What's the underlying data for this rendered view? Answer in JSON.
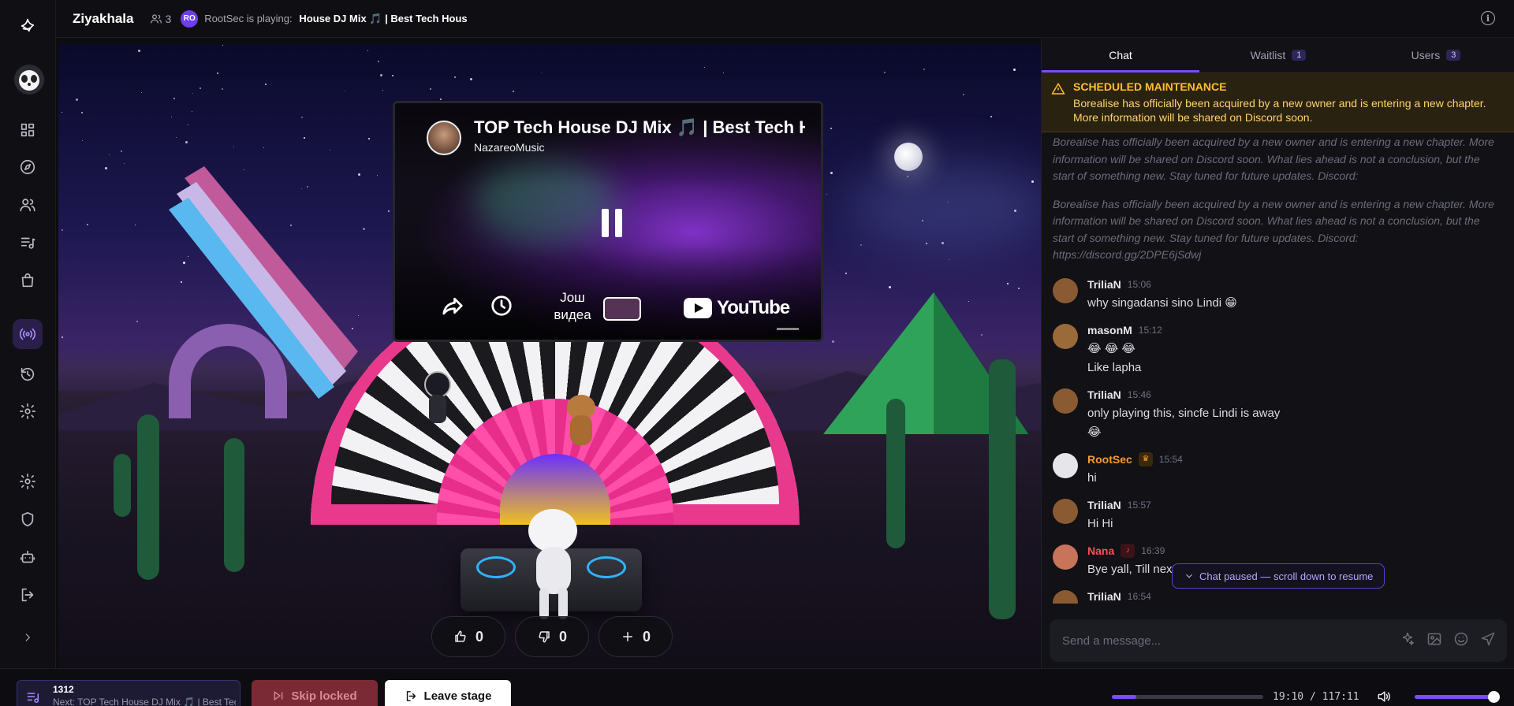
{
  "topbar": {
    "room_name": "Ziyakhala",
    "listener_count": "3",
    "dj_initials": "RO",
    "playing_label": "RootSec is playing:",
    "playing_title": "TOP Tech House DJ Mix 🎵 | Best Tech House"
  },
  "video": {
    "title": "TOP Tech House DJ Mix 🎵 | Best Tech House",
    "channel": "NazareoMusic",
    "watch_more": "Још\nвидеа",
    "youtube": "YouTube"
  },
  "votes": {
    "like": "0",
    "dislike": "0",
    "grab": "0"
  },
  "chat": {
    "tabs": [
      {
        "label": "Chat",
        "count": ""
      },
      {
        "label": "Waitlist",
        "count": "1"
      },
      {
        "label": "Users",
        "count": "3"
      }
    ],
    "maintenance": {
      "title": "SCHEDULED MAINTENANCE",
      "body": "Borealise has officially been acquired by a new owner and is entering a new chapter. More information will be shared on Discord soon."
    },
    "system_messages": [
      "Borealise has officially been acquired by a new owner and is entering a new chapter. More information will be shared on Discord soon. What lies ahead is not a conclusion, but the start of something new. Stay tuned for future updates. Discord:",
      "Borealise has officially been acquired by a new owner and is entering a new chapter. More information will be shared on Discord soon. What lies ahead is not a conclusion, but the start of something new. Stay tuned for future updates. Discord: https://discord.gg/2DPE6jSdwj"
    ],
    "messages": [
      {
        "user": "TriliaN",
        "time": "15:06",
        "lines": [
          "why singadansi sino Lindi 😁"
        ],
        "color": "#e8e8ee",
        "avatar": "#8a5a32"
      },
      {
        "user": "masonM",
        "time": "15:12",
        "lines": [
          "😂 😂 😂",
          "Like lapha"
        ],
        "color": "#e8e8ee",
        "avatar": "#9a6a38"
      },
      {
        "user": "TriliaN",
        "time": "15:46",
        "lines": [
          "only playing this, sincfe Lindi is away",
          "😂"
        ],
        "color": "#e8e8ee",
        "avatar": "#8a5a32"
      },
      {
        "user": "RootSec",
        "time": "15:54",
        "lines": [
          "hi"
        ],
        "color": "#ff9a2e",
        "avatar": "#e6e6ea"
      },
      {
        "user": "TriliaN",
        "time": "15:57",
        "lines": [
          "Hi Hi"
        ],
        "color": "#e8e8ee",
        "avatar": "#8a5a32"
      },
      {
        "user": "Nana",
        "time": "16:39",
        "lines": [
          "Bye yall, Till next time"
        ],
        "color": "#ff4d57",
        "avatar": "#c8735a"
      },
      {
        "user": "TriliaN",
        "time": "16:54",
        "lines": [],
        "color": "#e8e8ee",
        "avatar": "#8a5a32"
      }
    ],
    "paused_notice": "Chat paused — scroll down to resume",
    "input_placeholder": "Send a message..."
  },
  "bottombar": {
    "queue_count": "1312",
    "queue_next": "Next: TOP Tech House DJ Mix 🎵 | Best Tech House",
    "skip_label": "Skip locked",
    "leave_label": "Leave stage",
    "timecode": "19:10 / 117:11",
    "playback_progress": 0.163,
    "volume": 1.0
  },
  "colors": {
    "accent": "#7a4bff",
    "warning": "#ffbf2e",
    "danger": "#7a2a35"
  }
}
